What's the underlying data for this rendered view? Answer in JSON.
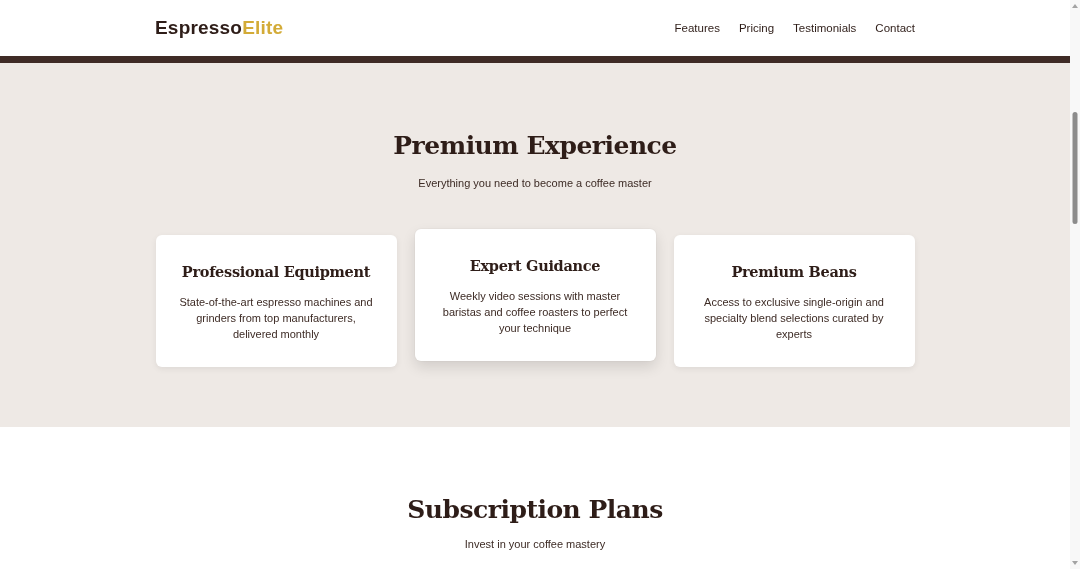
{
  "header": {
    "logo": {
      "part_1": "Espresso",
      "part_2": "Elite"
    },
    "nav": [
      "Features",
      "Pricing",
      "Testimonials",
      "Contact"
    ]
  },
  "features": {
    "title": "Premium Experience",
    "subtitle": "Everything you need to become a coffee master",
    "cards": [
      {
        "title": "Professional Equipment",
        "text": "State-of-the-art espresso machines and grinders from top manufacturers, delivered monthly",
        "raised": false
      },
      {
        "title": "Expert Guidance",
        "text": "Weekly video sessions with master baristas and coffee roasters to perfect your technique",
        "raised": true
      },
      {
        "title": "Premium Beans",
        "text": "Access to exclusive single-origin and specialty blend selections curated by experts",
        "raised": false
      }
    ]
  },
  "plans": {
    "title": "Subscription Plans",
    "subtitle": "Invest in your coffee mastery"
  }
}
